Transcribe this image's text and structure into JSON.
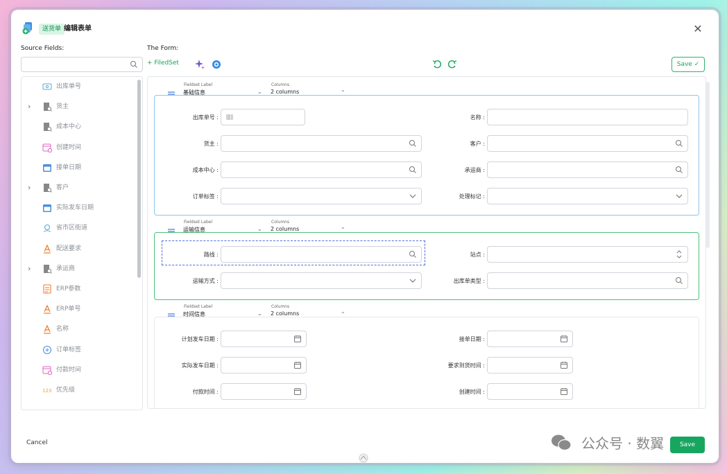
{
  "header": {
    "tag": "送货单",
    "title": "编辑表单"
  },
  "left": {
    "label": "Source Fields:",
    "search_placeholder": "",
    "items": [
      {
        "label": "出库单号",
        "icon": "barcode-icon",
        "expandable": false,
        "color": "#5aa7d8"
      },
      {
        "label": "货主",
        "icon": "building-search-icon",
        "expandable": true,
        "color": "#888888"
      },
      {
        "label": "成本中心",
        "icon": "building-search-icon",
        "expandable": false,
        "color": "#888888"
      },
      {
        "label": "创建时间",
        "icon": "calendar-clock-icon",
        "expandable": false,
        "color": "#e063c0"
      },
      {
        "label": "接单日期",
        "icon": "calendar-icon",
        "expandable": false,
        "color": "#4a8fe0"
      },
      {
        "label": "客户",
        "icon": "building-search-icon",
        "expandable": true,
        "color": "#888888"
      },
      {
        "label": "实际发车日期",
        "icon": "calendar-icon",
        "expandable": false,
        "color": "#4a8fe0"
      },
      {
        "label": "省市区街道",
        "icon": "location-icon",
        "expandable": false,
        "color": "#5aa7d8"
      },
      {
        "label": "配送要求",
        "icon": "text-a-icon",
        "expandable": false,
        "color": "#f07a2c"
      },
      {
        "label": "承运商",
        "icon": "building-search-icon",
        "expandable": true,
        "color": "#888888"
      },
      {
        "label": "ERP参数",
        "icon": "document-icon",
        "expandable": false,
        "color": "#f07a2c"
      },
      {
        "label": "ERP单号",
        "icon": "text-a-icon",
        "expandable": false,
        "color": "#f07a2c"
      },
      {
        "label": "名称",
        "icon": "text-a-icon",
        "expandable": false,
        "color": "#f07a2c"
      },
      {
        "label": "订单标签",
        "icon": "circle-plus-icon",
        "expandable": false,
        "color": "#4a8fe0"
      },
      {
        "label": "付款时间",
        "icon": "calendar-clock-icon",
        "expandable": false,
        "color": "#e063c0"
      },
      {
        "label": "优先级",
        "icon": "number-123-icon",
        "expandable": false,
        "color": "#f0a020"
      }
    ]
  },
  "form": {
    "label": "The Form:",
    "add_fieldset": "FiledSet",
    "save_label": "Save",
    "fieldset_label_caption": "Fieldset Label",
    "columns_caption": "Columns",
    "fieldsets": [
      {
        "name": "基础信息",
        "columns": "2 columns",
        "border": "#8ec5e8",
        "rows": [
          [
            "出库单号 :",
            "名称 :"
          ],
          [
            "货主 :",
            "客户 :"
          ],
          [
            "成本中心 :",
            "承运商 :"
          ],
          [
            "订单标签 :",
            "处理标记 :"
          ]
        ]
      },
      {
        "name": "运输信息",
        "columns": "2 columns",
        "border": "#4cc27a",
        "rows": [
          [
            "路线 :",
            "站点 :"
          ],
          [
            "运输方式 :",
            "出库单类型 :"
          ]
        ]
      },
      {
        "name": "时间信息",
        "columns": "2 columns",
        "border": "#e6e8eb",
        "rows": [
          [
            "计划发车日期 :",
            "接单日期 :"
          ],
          [
            "实际发车日期 :",
            "要求到货时间 :"
          ],
          [
            "付款时间 :",
            "创建时间 :"
          ]
        ]
      }
    ]
  },
  "footer": {
    "cancel_label": "Cancel",
    "save_label": "Save",
    "watermark": "公众号 · 数翼"
  },
  "colors": {
    "accent": "#19a35b",
    "selected": "#4a6edb"
  }
}
